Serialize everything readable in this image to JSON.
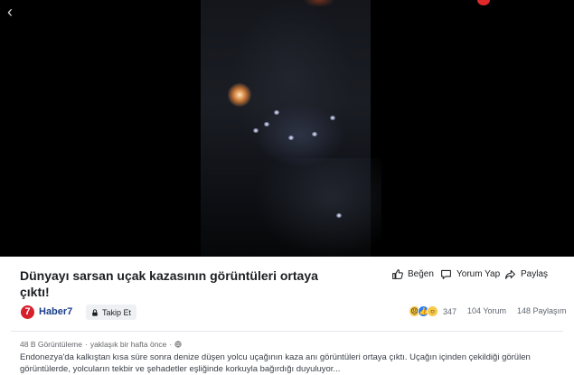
{
  "video": {
    "back_icon": "chevron-left-icon",
    "back_glyph": "‹"
  },
  "post": {
    "title": "Dünyayı sarsan uçak kazasının görüntüleri ortaya çıktı!",
    "actions": {
      "like_label": "Beğen",
      "comment_label": "Yorum Yap",
      "share_label": "Paylaş"
    },
    "publisher": {
      "logo_text": "7",
      "name": "Haber7",
      "follow_label": "Takip Et",
      "brand_color": "#d6202c"
    },
    "stats": {
      "reaction_count": "347",
      "comments": "104 Yorum",
      "shares": "148 Paylaşım"
    },
    "meta": {
      "views": "48 B Görüntüleme",
      "separator": "·",
      "time": "yaklaşık bir hafta önce",
      "separator2": "·"
    },
    "description": "Endonezya'da kalkıştan kısa süre sonra denize düşen yolcu uçağının kaza anı görüntüleri ortaya çıktı. Uçağın içinden çekildiği görülen görüntülerde, yolcuların tekbir ve şehadetler eşliğinde korkuyla bağırdığı duyuluyor..."
  }
}
